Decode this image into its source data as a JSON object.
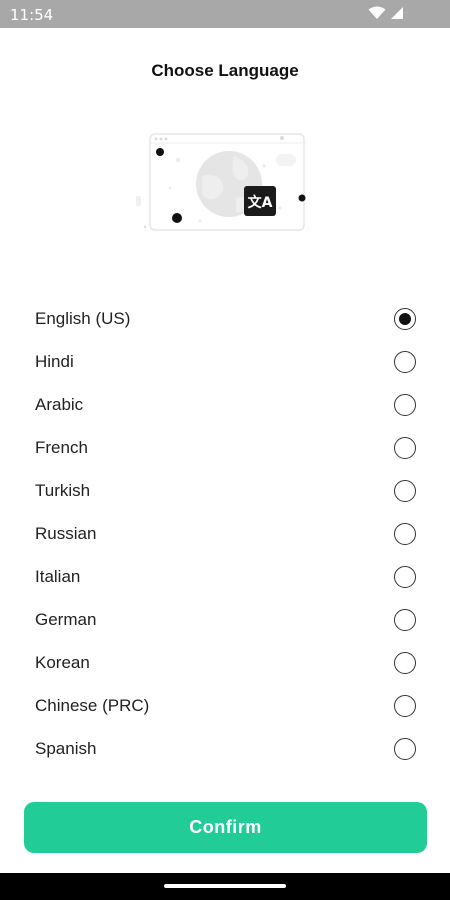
{
  "status_bar": {
    "time": "11:54",
    "wifi_icon": "wifi-icon",
    "signal_icon": "cell-signal-icon"
  },
  "header": {
    "title": "Choose Language"
  },
  "illustration": {
    "icon": "translate-icon",
    "badge_glyph": "文A"
  },
  "languages": [
    {
      "label": "English (US)",
      "selected": true
    },
    {
      "label": "Hindi",
      "selected": false
    },
    {
      "label": "Arabic",
      "selected": false
    },
    {
      "label": "French",
      "selected": false
    },
    {
      "label": "Turkish",
      "selected": false
    },
    {
      "label": "Russian",
      "selected": false
    },
    {
      "label": "Italian",
      "selected": false
    },
    {
      "label": "German",
      "selected": false
    },
    {
      "label": "Korean",
      "selected": false
    },
    {
      "label": "Chinese (PRC)",
      "selected": false
    },
    {
      "label": "Spanish",
      "selected": false
    }
  ],
  "confirm": {
    "label": "Confirm"
  },
  "colors": {
    "accent": "#22cc96",
    "status_bar": "#a8a8a8",
    "nav_bar": "#000000"
  }
}
